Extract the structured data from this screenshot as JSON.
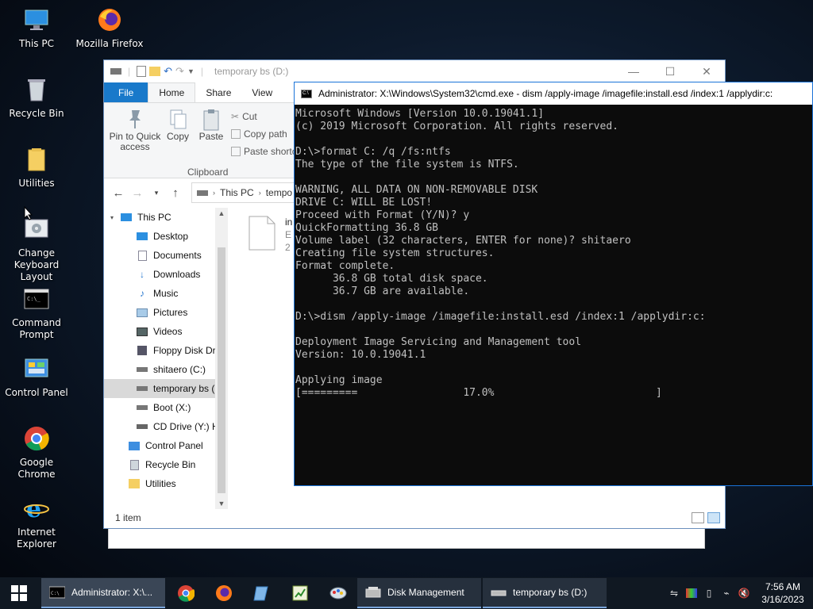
{
  "desktop": {
    "icons": [
      {
        "label": "This PC"
      },
      {
        "label": "Mozilla Firefox"
      },
      {
        "label": "Recycle Bin"
      },
      {
        "label": "Utilities"
      },
      {
        "label": "Change Keyboard Layout"
      },
      {
        "label": "Command Prompt"
      },
      {
        "label": "Control Panel"
      },
      {
        "label": "Google Chrome"
      },
      {
        "label": "Internet Explorer"
      }
    ]
  },
  "explorer": {
    "title": "temporary bs (D:)",
    "tabs": {
      "file": "File",
      "home": "Home",
      "share": "Share",
      "view": "View"
    },
    "ribbon": {
      "pin": "Pin to Quick access",
      "copy": "Copy",
      "paste": "Paste",
      "cut": "Cut",
      "copy_path": "Copy path",
      "paste_shortcut": "Paste shortc",
      "group": "Clipboard"
    },
    "address": {
      "this_pc": "This PC",
      "current": "tempo"
    },
    "nav": [
      {
        "label": "This PC"
      },
      {
        "label": "Desktop"
      },
      {
        "label": "Documents"
      },
      {
        "label": "Downloads"
      },
      {
        "label": "Music"
      },
      {
        "label": "Pictures"
      },
      {
        "label": "Videos"
      },
      {
        "label": "Floppy Disk Dri"
      },
      {
        "label": "shitaero (C:)"
      },
      {
        "label": "temporary bs ("
      },
      {
        "label": "Boot (X:)"
      },
      {
        "label": "CD Drive (Y:) H"
      },
      {
        "label": "Control Panel"
      },
      {
        "label": "Recycle Bin"
      },
      {
        "label": "Utilities"
      }
    ],
    "file": {
      "name": "in",
      "line2": "E",
      "line3": "2"
    },
    "status": "1 item"
  },
  "cmd": {
    "title": "Administrator: X:\\Windows\\System32\\cmd.exe - dism  /apply-image /imagefile:install.esd /index:1 /applydir:c:",
    "lines": [
      "Microsoft Windows [Version 10.0.19041.1]",
      "(c) 2019 Microsoft Corporation. All rights reserved.",
      "",
      "D:\\>format C: /q /fs:ntfs",
      "The type of the file system is NTFS.",
      "",
      "WARNING, ALL DATA ON NON-REMOVABLE DISK",
      "DRIVE C: WILL BE LOST!",
      "Proceed with Format (Y/N)? y",
      "QuickFormatting 36.8 GB",
      "Volume label (32 characters, ENTER for none)? shitaero",
      "Creating file system structures.",
      "Format complete.",
      "      36.8 GB total disk space.",
      "      36.7 GB are available.",
      "",
      "D:\\>dism /apply-image /imagefile:install.esd /index:1 /applydir:c:",
      "",
      "Deployment Image Servicing and Management tool",
      "Version: 10.0.19041.1",
      "",
      "Applying image",
      "[=========                 17.0%                          ]"
    ],
    "progress": 0.17
  },
  "taskbar": {
    "tasks": [
      {
        "label": "Administrator: X:\\..."
      },
      {
        "label": "Disk Management"
      },
      {
        "label": "temporary bs (D:)"
      }
    ],
    "clock": {
      "time": "7:56 AM",
      "date": "3/16/2023"
    }
  }
}
